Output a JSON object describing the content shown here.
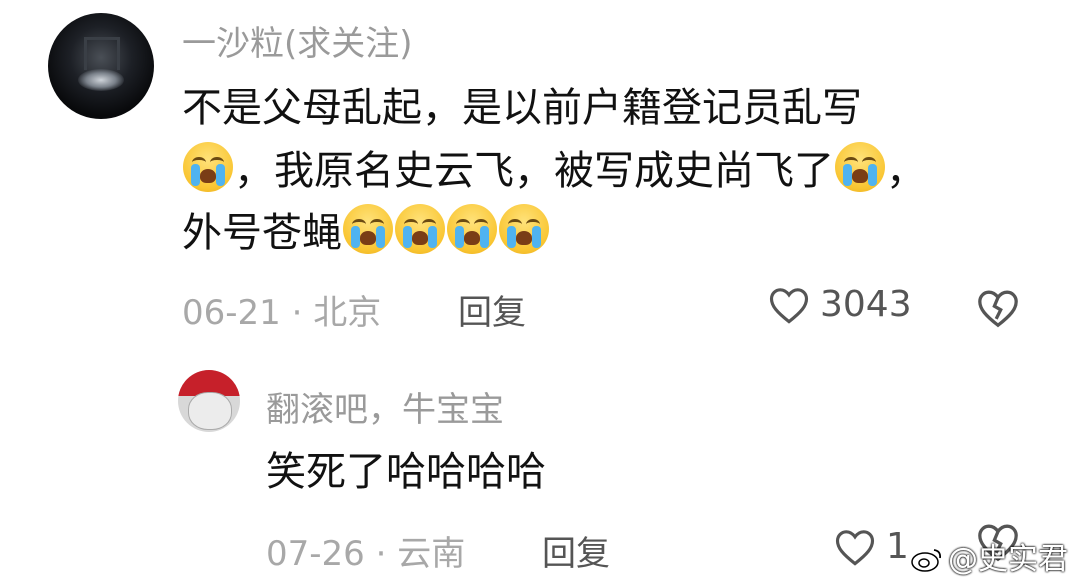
{
  "comment": {
    "username": "一沙粒(求关注)",
    "lines": [
      [
        "不是父母乱起，是以前户籍登记员乱写"
      ],
      [
        "，我原名史云飞，被写成史尚飞了",
        "，"
      ],
      [
        "外号苍蝇"
      ]
    ],
    "meta": "06-21 · 北京",
    "reply_label": "回复",
    "like_count": "3043"
  },
  "reply": {
    "username": "翻滚吧，牛宝宝",
    "content": "笑死了哈哈哈哈",
    "meta": "07-26 · 云南",
    "reply_label": "回复",
    "like_count": "1"
  },
  "watermark": "@史实君",
  "icons": {
    "emoji": "loudly-crying-face-emoji",
    "like": "heart-icon",
    "dislike": "broken-heart-icon",
    "weibo": "weibo-logo-icon"
  }
}
